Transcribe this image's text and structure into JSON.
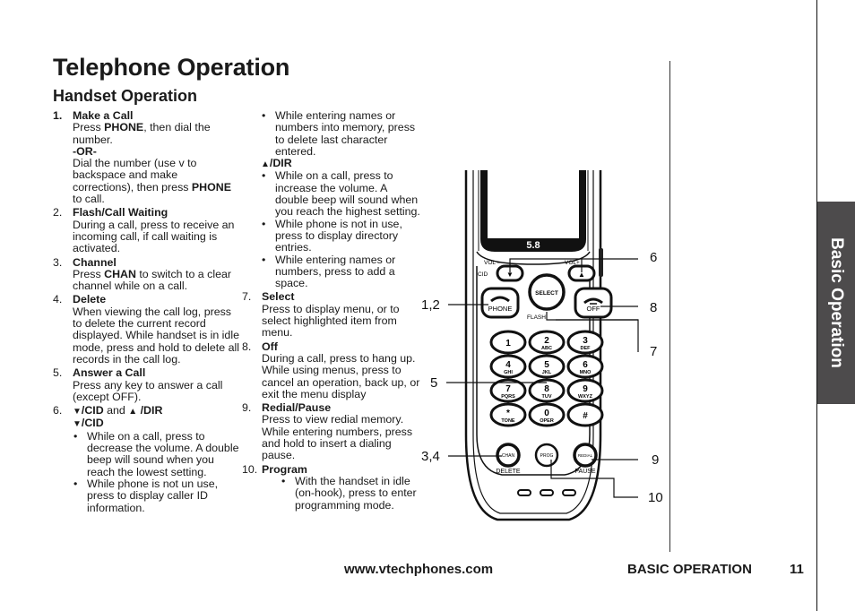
{
  "page": {
    "title": "Telephone Operation",
    "section_title": "Handset Operation"
  },
  "column1": {
    "items": [
      {
        "num": "1.",
        "head": "Make a Call",
        "text_a_pre": "Press ",
        "text_a_bold": "PHONE",
        "text_a_post": ", then dial the number.",
        "or": "-OR-",
        "text_b": "Dial the number (use v to backspace and make corrections), then press ",
        "text_b_bold": "PHONE",
        "text_b_post": " to call."
      },
      {
        "num": "2.",
        "head": "Flash/Call Waiting",
        "text": "During a call, press to receive an incoming call, if call waiting is activated."
      },
      {
        "num": "3.",
        "head": "Channel",
        "text_pre": "Press ",
        "text_bold": "CHAN",
        "text_post": " to switch to a clear channel while on a call."
      },
      {
        "num": "4.",
        "head": "Delete",
        "text": "When viewing the call log, press to delete the current record displayed. While handset is in idle mode, press and hold to delete all records in the call log."
      },
      {
        "num": "5.",
        "head": "Answer a Call",
        "text": "Press any key to answer a call (except OFF)."
      },
      {
        "num": "6.",
        "head_down": "▼",
        "head_cid": "/CID",
        "head_and": " and ",
        "head_up": "▲",
        "head_dir": " /DIR",
        "sub_down": "▼",
        "sub_label": "/CID",
        "bullets": [
          "While on a call, press to decrease the volume. A double beep will sound when you reach the lowest setting.",
          "While phone is not un use, press to display caller ID information."
        ]
      }
    ]
  },
  "column2": {
    "cid_bullet_cont": "While entering names or numbers into memory, press to delete last character entered.",
    "dir_sub_icon": "▲",
    "dir_sub_label": "/DIR",
    "dir_bullets": [
      "While on a call, press to increase the volume. A double beep will sound when you reach the highest setting.",
      "While phone is not in use, press to display directory entries.",
      "While entering names or numbers, press to add a space."
    ],
    "items": [
      {
        "num": "7.",
        "head": "Select",
        "text": "Press to display menu, or to select highlighted item from menu."
      },
      {
        "num": "8.",
        "head": "Off",
        "text": "During a call, press to hang up. While using menus, press to cancel an operation, back up, or exit the menu display"
      },
      {
        "num": "9.",
        "head": "Redial/Pause",
        "text": "Press to view redial memory. While entering numbers, press and hold to insert a dialing pause."
      },
      {
        "num": "10.",
        "head": "Program",
        "bullets": [
          "With the handset in idle (on-hook), press to enter programming mode."
        ]
      }
    ]
  },
  "phone": {
    "brand_badge": "5.8",
    "labels": {
      "vol_minus": "VOL –",
      "vol_plus": "VOL+",
      "cid": "CID",
      "dir": "DIR",
      "phone": "PHONE",
      "select": "SELECT",
      "off": "OFF",
      "flash": "FLASH",
      "chan": "CHAN",
      "delete": "DELETE",
      "prog": "PROG",
      "redial": "REDIAL",
      "pause": "PAUSE"
    },
    "keys": [
      {
        "digit": "1",
        "letters": ""
      },
      {
        "digit": "2",
        "letters": "ABC"
      },
      {
        "digit": "3",
        "letters": "DEF"
      },
      {
        "digit": "4",
        "letters": "GHI"
      },
      {
        "digit": "5",
        "letters": "JKL"
      },
      {
        "digit": "6",
        "letters": "MNO"
      },
      {
        "digit": "7",
        "letters": "PQRS"
      },
      {
        "digit": "8",
        "letters": "TUV"
      },
      {
        "digit": "9",
        "letters": "WXYZ"
      },
      {
        "digit": "*",
        "letters": "TONE"
      },
      {
        "digit": "0",
        "letters": "OPER"
      },
      {
        "digit": "#",
        "letters": ""
      }
    ],
    "callouts": {
      "c6": "6",
      "c12": "1,2",
      "c8": "8",
      "c7": "7",
      "c5": "5",
      "c34": "3,4",
      "c9": "9",
      "c10": "10"
    }
  },
  "side_tab": "Basic Operation",
  "footer": {
    "url": "www.vtechphones.com",
    "section": "BASIC OPERATION",
    "page_number": "11"
  },
  "colors": {
    "tab_background": "#4d4b4c",
    "text": "#1a1a1a"
  }
}
